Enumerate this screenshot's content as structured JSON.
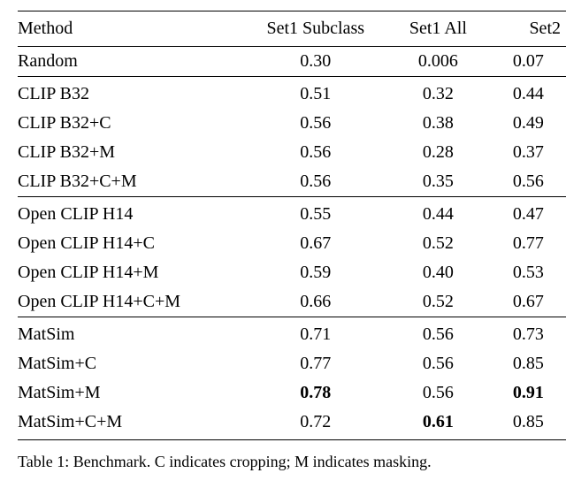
{
  "chart_data": {
    "type": "table",
    "title": "Table 1",
    "columns": [
      "Method",
      "Set1 Subclass",
      "Set1 All",
      "Set2"
    ],
    "groups": [
      {
        "rows": [
          {
            "method": "Random",
            "sub": "0.30",
            "all": "0.006",
            "set2": "0.07"
          }
        ]
      },
      {
        "rows": [
          {
            "method": "CLIP B32",
            "sub": "0.51",
            "all": "0.32",
            "set2": "0.44"
          },
          {
            "method": "CLIP B32+C",
            "sub": "0.56",
            "all": "0.38",
            "set2": "0.49"
          },
          {
            "method": "CLIP B32+M",
            "sub": "0.56",
            "all": "0.28",
            "set2": "0.37"
          },
          {
            "method": "CLIP B32+C+M",
            "sub": "0.56",
            "all": "0.35",
            "set2": "0.56"
          }
        ]
      },
      {
        "rows": [
          {
            "method": "Open CLIP H14",
            "sub": "0.55",
            "all": "0.44",
            "set2": "0.47"
          },
          {
            "method": "Open CLIP H14+C",
            "sub": "0.67",
            "all": "0.52",
            "set2": "0.77"
          },
          {
            "method": "Open CLIP H14+M",
            "sub": "0.59",
            "all": "0.40",
            "set2": "0.53"
          },
          {
            "method": "Open CLIP H14+C+M",
            "sub": "0.66",
            "all": "0.52",
            "set2": "0.67"
          }
        ]
      },
      {
        "rows": [
          {
            "method": "MatSim",
            "sub": "0.71",
            "all": "0.56",
            "set2": "0.73"
          },
          {
            "method": "MatSim+C",
            "sub": "0.77",
            "all": "0.56",
            "set2": "0.85"
          },
          {
            "method": "MatSim+M",
            "sub": "0.78",
            "sub_bold": true,
            "all": "0.56",
            "set2": "0.91",
            "set2_bold": true
          },
          {
            "method": "MatSim+C+M",
            "sub": "0.72",
            "all": "0.61",
            "all_bold": true,
            "set2": "0.85"
          }
        ]
      }
    ]
  },
  "caption": "Table 1: Benchmark. C indicates cropping; M indicates masking."
}
